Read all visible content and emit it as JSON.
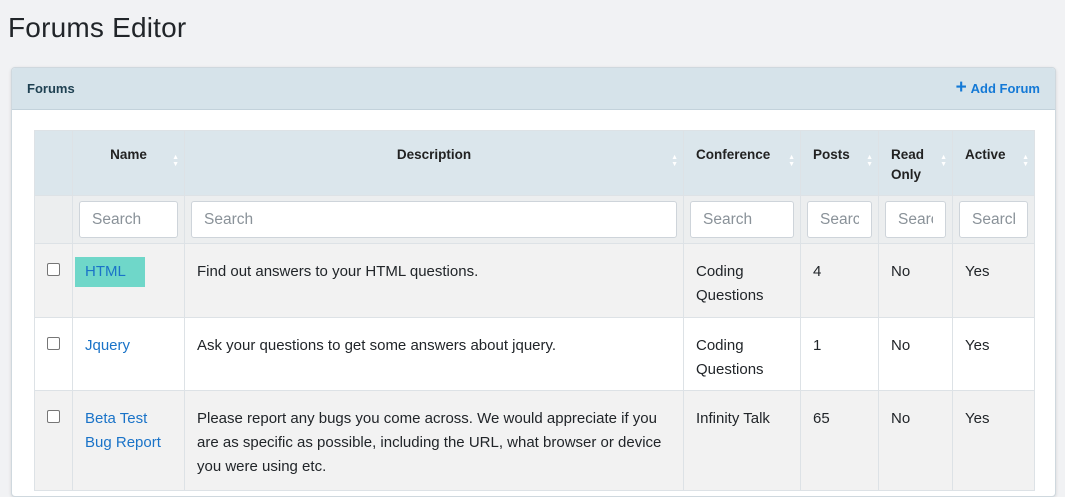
{
  "page": {
    "title": "Forums Editor"
  },
  "card": {
    "title": "Forums",
    "add_label": "Add Forum"
  },
  "table": {
    "headers": {
      "name": "Name",
      "description": "Description",
      "conference": "Conference",
      "posts": "Posts",
      "read_only": "Read Only",
      "active": "Active"
    },
    "search_placeholders": {
      "name": "Search",
      "description": "Search",
      "conference": "Search",
      "posts": "Search",
      "read_only": "Search",
      "active": "Search"
    },
    "rows": [
      {
        "name": "HTML",
        "description": "Find out answers to your HTML questions.",
        "conference": "Coding Questions",
        "posts": "4",
        "read_only": "No",
        "active": "Yes"
      },
      {
        "name": "Jquery",
        "description": "Ask your questions to get some answers about jquery.",
        "conference": "Coding Questions",
        "posts": "1",
        "read_only": "No",
        "active": "Yes"
      },
      {
        "name": "Beta Test Bug Report",
        "description": "Please report any bugs you come across. We would appreciate if you are as specific as possible, including the URL, what browser or device you were using etc.",
        "conference": "Infinity Talk",
        "posts": "65",
        "read_only": "No",
        "active": "Yes"
      }
    ]
  },
  "colors": {
    "header_bg": "#d6e3ea",
    "link": "#1a73c8",
    "highlight": "#6fd7c9"
  }
}
